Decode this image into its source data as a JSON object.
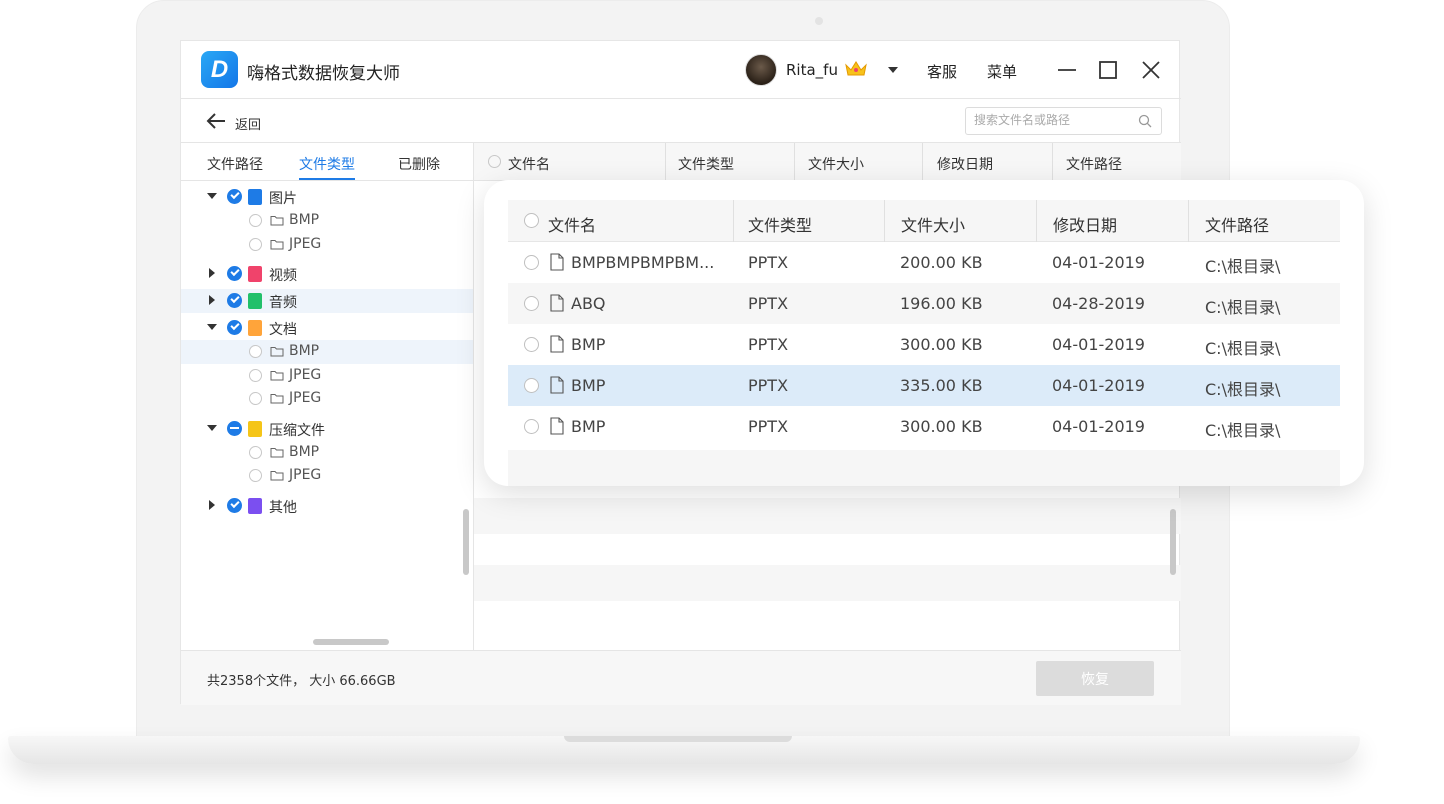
{
  "window": {
    "app_title": "嗨格式数据恢复大师",
    "logo_letter": "D",
    "username": "Rita_fu",
    "service_label": "客服",
    "menu_label": "菜单"
  },
  "toolbar": {
    "back_label": "返回",
    "search_placeholder": "搜索文件名或路径"
  },
  "left_tabs": [
    "文件路径",
    "文件类型",
    "已删除"
  ],
  "active_tab": "文件类型",
  "tree": [
    {
      "label": "图片",
      "color": "#1e7be6",
      "expanded": true,
      "children": [
        "BMP",
        "JPEG"
      ]
    },
    {
      "label": "视频",
      "color": "#f0436b",
      "expanded": false,
      "children": []
    },
    {
      "label": "音频",
      "color": "#22c06a",
      "expanded": false,
      "children": []
    },
    {
      "label": "文档",
      "color": "#ffa43a",
      "expanded": true,
      "children": [
        "BMP",
        "JPEG",
        "JPEG"
      ]
    },
    {
      "label": "压缩文件",
      "color": "#f5c518",
      "expanded": true,
      "children": [
        "BMP",
        "JPEG"
      ]
    },
    {
      "label": "其他",
      "color": "#7b4ff0",
      "expanded": false,
      "children": []
    }
  ],
  "columns": [
    "文件名",
    "文件类型",
    "文件大小",
    "修改日期",
    "文件路径"
  ],
  "rows": [
    {
      "name": "BMPBMPBMPBM...",
      "type": "PPTX",
      "size": "200.00 KB",
      "date": "04-01-2019",
      "path": "C:\\根目录\\"
    },
    {
      "name": "ABQ",
      "type": "PPTX",
      "size": "196.00 KB",
      "date": "04-28-2019",
      "path": "C:\\根目录\\"
    },
    {
      "name": "BMP",
      "type": "PPTX",
      "size": "300.00 KB",
      "date": "04-01-2019",
      "path": "C:\\根目录\\"
    },
    {
      "name": "BMP",
      "type": "PPTX",
      "size": "335.00 KB",
      "date": "04-01-2019",
      "path": "C:\\根目录\\"
    },
    {
      "name": "BMP",
      "type": "PPTX",
      "size": "300.00 KB",
      "date": "04-01-2019",
      "path": "C:\\根目录\\"
    }
  ],
  "selected_row": 3,
  "footer": {
    "summary": "共2358个文件， 大小 66.66GB",
    "recover_label": "恢复"
  }
}
